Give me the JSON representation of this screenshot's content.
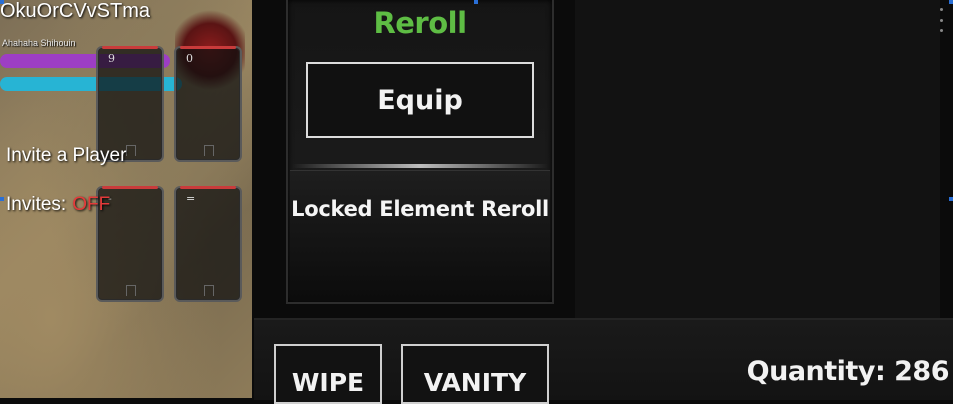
{
  "player": {
    "name": "OkuOrCVvSTma",
    "subtitle": "Ahahaha Shihouin"
  },
  "party": {
    "invite_label": "Invite a Player",
    "invites_key": "Invites:",
    "invites_value": "OFF",
    "slots": [
      {
        "key": "9"
      },
      {
        "key": "0"
      },
      {
        "key": "-"
      },
      {
        "key": "="
      }
    ]
  },
  "reroll_panel": {
    "reroll_label": "Reroll",
    "equip_label": "Equip",
    "locked_element_label": "Locked Element Reroll"
  },
  "bottom": {
    "wipe_label": "WIPE",
    "vanity_label": "VANITY",
    "quantity_text": "Quantity: 286"
  },
  "colors": {
    "reroll_green": "#5ebd44",
    "invites_off_red": "#e53a3a",
    "health_bar_purple": "#9d3ec4",
    "mana_bar_cyan": "#27b4d4"
  }
}
